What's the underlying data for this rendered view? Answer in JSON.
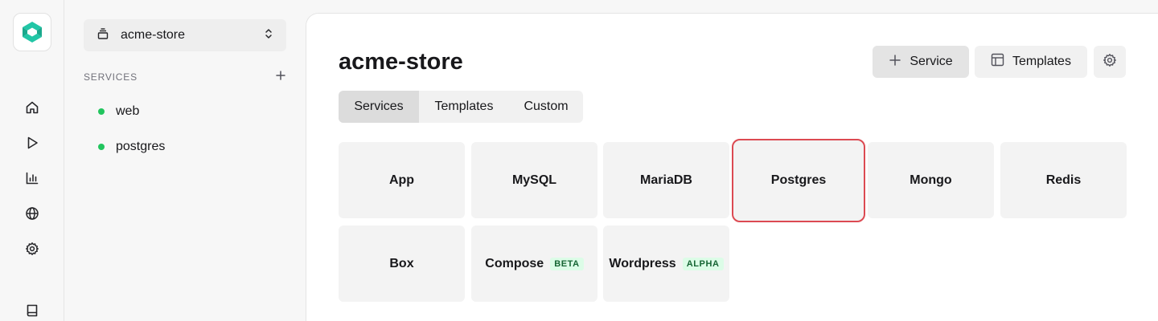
{
  "sidebar": {
    "project_name": "acme-store",
    "section_title": "SERVICES",
    "services": [
      {
        "label": "web",
        "status_color": "#22c55e"
      },
      {
        "label": "postgres",
        "status_color": "#22c55e"
      }
    ]
  },
  "rail": {
    "icons": [
      "home-icon",
      "play-icon",
      "chart-icon",
      "globe-icon",
      "gear-icon",
      "book-icon"
    ]
  },
  "main": {
    "title": "acme-store",
    "header_buttons": {
      "service_label": "Service",
      "templates_label": "Templates"
    },
    "tabs": [
      {
        "label": "Services",
        "active": true
      },
      {
        "label": "Templates",
        "active": false
      },
      {
        "label": "Custom",
        "active": false
      }
    ],
    "tiles": [
      {
        "label": "App"
      },
      {
        "label": "MySQL"
      },
      {
        "label": "MariaDB"
      },
      {
        "label": "Postgres",
        "selected": true
      },
      {
        "label": "Mongo"
      },
      {
        "label": "Redis"
      },
      {
        "label": "Box"
      },
      {
        "label": "Compose",
        "badge": "BETA"
      },
      {
        "label": "Wordpress",
        "badge": "ALPHA"
      }
    ]
  },
  "colors": {
    "brand": "#22c6a6",
    "status_running": "#22c55e",
    "selected_outline": "#dc4a52",
    "badge_bg": "#dcfce7",
    "badge_text": "#166534"
  }
}
